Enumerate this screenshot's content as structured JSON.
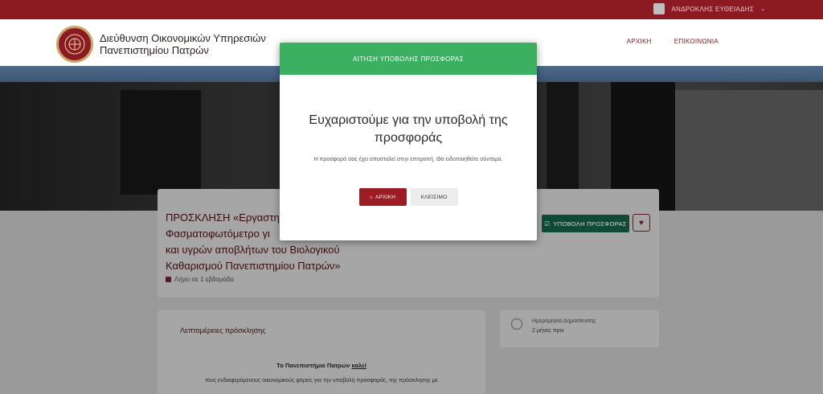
{
  "topbar": {
    "user_name": "ΑΝΔΡΟΚΛΗΣ ΕΥΘΕΙΑΔΗΣ",
    "caret": "⌄"
  },
  "header": {
    "title_line1": "Διεύθυνση Οικονομικών Υπηρεσιών",
    "title_line2": "Πανεπιστημίου Πατρών",
    "nav": {
      "home": "ΑΡΧΙΚΗ",
      "contact": "ΕΠΙΚΟΙΝΩΝΙΑ"
    }
  },
  "card": {
    "title_line1": "ΠΡΟΣΚΛΗΣΗ «Εργαστηρ",
    "title_line2": "Φασματοφωτόμετρο γι",
    "title_line3": "και υγρών αποβλήτων του Βιολογικού",
    "title_line4": "Καθαρισμού Πανεπιστημίου Πατρών»",
    "expires": "Λήγει σε 1 εβδομάδα",
    "submit_label": "ΥΠΟΒΟΛΗ ΠΡΟΣΦΟΡΑΣ",
    "heart": "♥"
  },
  "details": {
    "heading": "Λεπτομέρειες πρόσκλησης",
    "univ_prefix": "Το Πανεπιστήμιο Πατρών ",
    "univ_link": "καλεί",
    "text": "τους ενδιαφερόμενους οικονομικούς φορείς για την υποβολή προσφοράς, της πρόσκλησης με"
  },
  "side": {
    "label": "Ημερομηνία Δημοσίευσης",
    "value": "2 μήνες πριν"
  },
  "modal": {
    "header": "ΑΙΤΗΣΗ ΥΠΟΒΟΛΗΣ ΠΡΟΣΦΟΡΑΣ",
    "title": "Ευχαριστούμε για την υποβολή της προσφοράς",
    "text": "Η προσφορά σας έχει αποσταλεί στην επιτροπή. Θα ειδοποιηθείτε σύντομα.",
    "home_label": "ΑΡΧΙΚΗ",
    "close_label": "ΚΛΕΙΣΙΜΟ"
  },
  "colors": {
    "brand": "#8b1a22",
    "success": "#3bb061",
    "teal": "#167a58"
  }
}
